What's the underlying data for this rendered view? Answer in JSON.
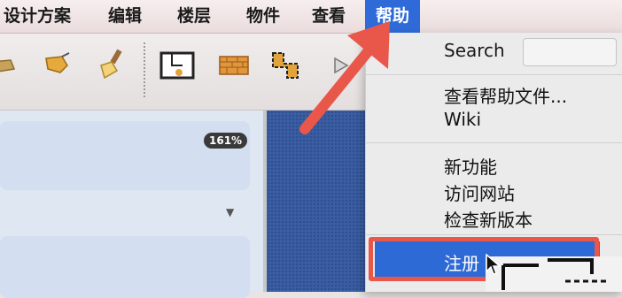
{
  "menubar": {
    "items": [
      "设计方案",
      "编辑",
      "楼层",
      "物件",
      "查看"
    ],
    "active_item": "帮助"
  },
  "toolbar": {
    "icons": [
      "shape-icon",
      "bucket-icon",
      "paintbrush-icon",
      "room-plan-icon",
      "brick-wall-icon",
      "room-corner-icon",
      "arrow-tool-icon"
    ]
  },
  "left_panel": {
    "zoom_level": "161%"
  },
  "help_menu": {
    "search_label": "Search",
    "search_value": "",
    "items": [
      "查看帮助文件...",
      "Wiki",
      "新功能",
      "访问网站",
      "检查新版本"
    ],
    "highlighted_item": "注册"
  },
  "colors": {
    "accent_blue": "#2f6bd8",
    "annotation_red": "#e8574a"
  }
}
